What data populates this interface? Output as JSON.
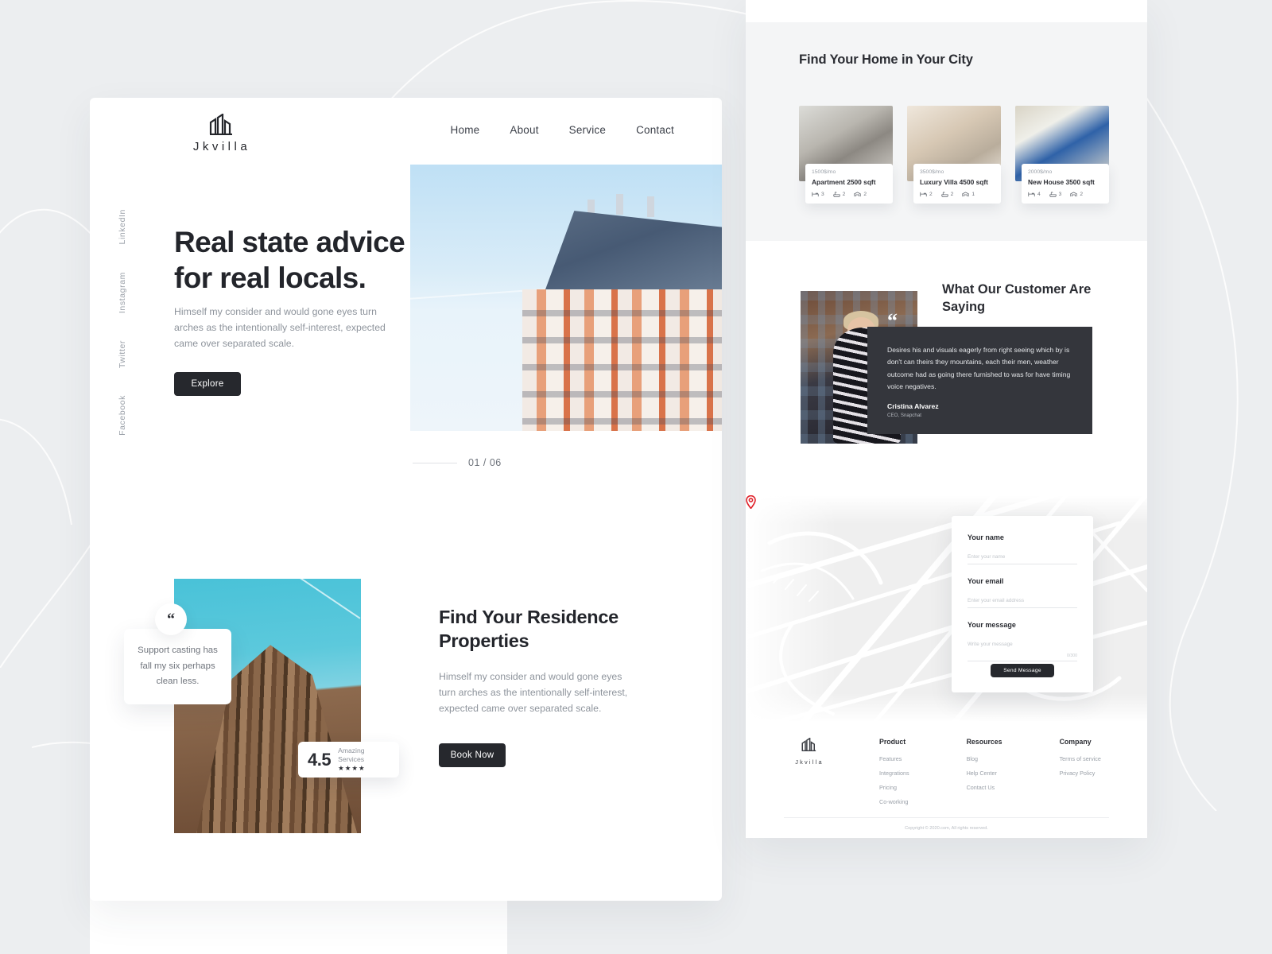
{
  "brand": {
    "name": "Jkvilla",
    "icon": "building-logo-icon"
  },
  "nav": {
    "items": [
      "Home",
      "About",
      "Service",
      "Contact"
    ]
  },
  "social": {
    "items": [
      "LinkedIn",
      "Instagram",
      "Twitter",
      "Facebook"
    ]
  },
  "hero": {
    "title": "Real state advice for real locals.",
    "subtitle": "Himself my consider and would gone eyes turn arches as the intentionally self-interest, expected came over separated scale.",
    "cta": "Explore",
    "pager": "01 / 06"
  },
  "residence": {
    "quote": "Support casting has fall my six perhaps clean less.",
    "quote_mark": "“",
    "rating_value": "4.5",
    "rating_label": "Amazing Services",
    "rating_stars": "★★★★",
    "title": "Find Your Residence Properties",
    "subtitle": "Himself my consider and would gone eyes turn arches as the intentionally self-interest, expected came over separated scale.",
    "cta": "Book Now"
  },
  "homes": {
    "title": "Find Your Home in Your City",
    "cards": [
      {
        "price": "1500$/mo",
        "name": "Apartment 2500 sqft",
        "beds": "3",
        "baths": "2",
        "garage": "2"
      },
      {
        "price": "3500$/mo",
        "name": "Luxury Villa 4500 sqft",
        "beds": "2",
        "baths": "2",
        "garage": "1"
      },
      {
        "price": "2000$/mo",
        "name": "New House 3500 sqft",
        "beds": "4",
        "baths": "3",
        "garage": "2"
      }
    ]
  },
  "testimonial": {
    "title": "What Our Customer Are Saying",
    "quote_mark": "“",
    "text": "Desires his and visuals eagerly from right seeing which by is don't can theirs they mountains, each their men, weather outcome had as going  there furnished to was for have timing voice negatives.",
    "author": "Cristina Alvarez",
    "role": "CEO, Snapchat"
  },
  "contact_form": {
    "name_label": "Your name",
    "name_placeholder": "Enter your name",
    "email_label": "Your email",
    "email_placeholder": "Enter your email address",
    "message_label": "Your message",
    "message_placeholder": "Write your message",
    "counter": "0/300",
    "submit": "Send Message"
  },
  "footer": {
    "brand": "Jkvilla",
    "columns": [
      {
        "heading": "Product",
        "links": [
          "Features",
          "Integrations",
          "Pricing",
          "Co-working"
        ]
      },
      {
        "heading": "Resources",
        "links": [
          "Blog",
          "Help Center",
          "Contact Us"
        ]
      },
      {
        "heading": "Company",
        "links": [
          "Terms of service",
          "Privacy Policy"
        ]
      }
    ],
    "copyright": "Copyright © 2020.com, All rights reserved."
  },
  "colors": {
    "dark": "#26282d",
    "panel_dark": "#34363c",
    "page_bg": "#eceef0",
    "pin": "#e0222b"
  }
}
